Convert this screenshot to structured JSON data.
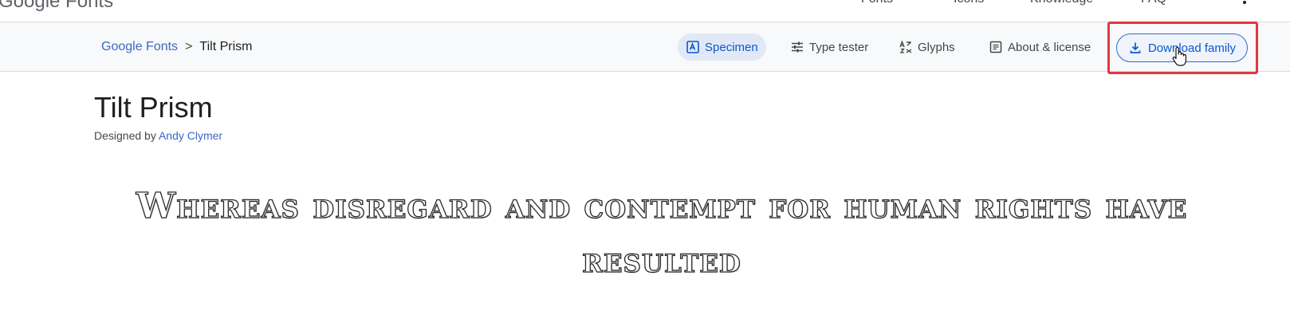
{
  "header": {
    "logo": "Google Fonts",
    "nav": [
      "Fonts",
      "Icons",
      "Knowledge",
      "FAQ"
    ],
    "more_icon": "more-vert-icon"
  },
  "breadcrumb": {
    "root": "Google Fonts",
    "separator": ">",
    "current": "Tilt Prism"
  },
  "tabs": [
    {
      "label": "Specimen",
      "icon": "specimen-icon",
      "active": true
    },
    {
      "label": "Type tester",
      "icon": "tune-icon",
      "active": false
    },
    {
      "label": "Glyphs",
      "icon": "glyphs-icon",
      "active": false
    },
    {
      "label": "About & license",
      "icon": "article-icon",
      "active": false
    }
  ],
  "download": {
    "label": "Download family",
    "icon": "download-icon"
  },
  "font": {
    "name": "Tilt Prism",
    "designed_by": "Designed by",
    "designer": "Andy Clymer"
  },
  "specimen": {
    "text": "Whereas disregard and contempt for human rights have resulted"
  },
  "colors": {
    "accent": "#0b57d0",
    "link": "#3b67c5",
    "active_tab_bg": "#e1e9f7",
    "highlight": "#e0393e"
  }
}
